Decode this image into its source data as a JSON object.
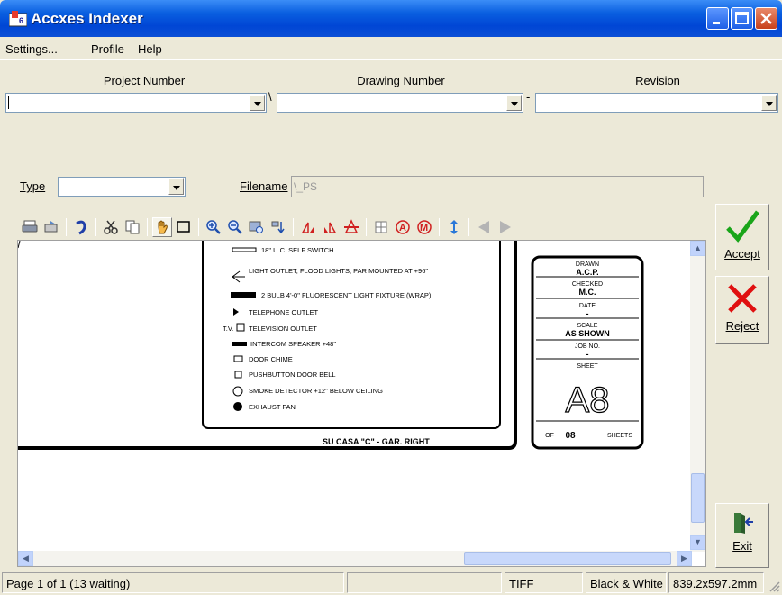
{
  "window": {
    "title": "Accxes Indexer"
  },
  "menu": {
    "items": [
      "Settings...",
      "Profile",
      "Help"
    ]
  },
  "fields": {
    "project_number": {
      "label": "Project Number",
      "value": ""
    },
    "drawing_number": {
      "label": "Drawing Number",
      "value": ""
    },
    "revision": {
      "label": "Revision",
      "value": ""
    },
    "sep1": "\\",
    "sep2": "-",
    "type": {
      "label": "Type",
      "value": ""
    },
    "filename": {
      "label": "Filename",
      "value": "\\_PS"
    }
  },
  "toolbar": {
    "icons": [
      "print-icon",
      "print-setup-icon",
      "undo-icon",
      "cut-icon",
      "copy-icon",
      "pan-hand-icon",
      "select-rect-icon",
      "zoom-in-icon",
      "zoom-out-icon",
      "zoom-window-icon",
      "zoom-fit-icon",
      "rotate-left-icon",
      "rotate-right-icon",
      "flip-icon",
      "grid-icon",
      "redline-a-icon",
      "redline-m-icon",
      "fit-height-icon",
      "prev-page-icon",
      "next-page-icon"
    ]
  },
  "drawing": {
    "legend": [
      "18\" U.C. SELF SWITCH",
      "LIGHT OUTLET, FLOOD LIGHTS, PAR MOUNTED AT +96\"",
      "2 BULB 4'-0\" FLUORESCENT LIGHT FIXTURE (WRAP)",
      "TELEPHONE OUTLET",
      "TELEVISION OUTLET",
      "INTERCOM SPEAKER +48\"",
      "DOOR CHIME",
      "PUSHBUTTON DOOR BELL",
      "SMOKE DETECTOR +12\" BELOW CEILING",
      "EXHAUST FAN"
    ],
    "tv_prefix": "T.V.",
    "plan_title": "SU CASA \"C\" - GAR. RIGHT",
    "title_block": {
      "drawn_label": "DRAWN",
      "drawn": "A.C.P.",
      "checked_label": "CHECKED",
      "checked": "M.C.",
      "date_label": "DATE",
      "date": "-",
      "scale_label": "SCALE",
      "scale": "AS SHOWN",
      "job_label": "JOB NO.",
      "job": "-",
      "sheet_label": "SHEET",
      "sheet": "A8",
      "of_label": "OF",
      "of": "08",
      "sheets_label": "SHEETS"
    }
  },
  "buttons": {
    "accept": "Accept",
    "reject": "Reject",
    "exit": "Exit"
  },
  "status": {
    "page": "Page 1 of 1 (13 waiting)",
    "empty": "",
    "format": "TIFF",
    "color": "Black & White",
    "size": "839.2x597.2mm"
  },
  "colors": {
    "title_bar": "#0a5fe0",
    "accept": "#1aa51a",
    "reject": "#e01010"
  }
}
